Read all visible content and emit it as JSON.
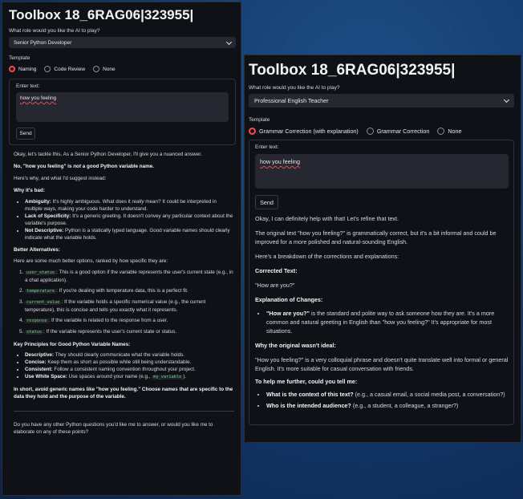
{
  "left": {
    "title": "Toolbox 18_6RAG06|323955|",
    "role_label": "What role would you like the AI to play?",
    "role_value": "Senior Python Developer",
    "template_label": "Template",
    "templates": [
      "Naming",
      "Code Review",
      "None"
    ],
    "selected_template": "Naming",
    "enter_label": "Enter text:",
    "input_text": "how you feeling",
    "send": "Send",
    "response": {
      "intro": "Okay, let's tackle this. As a Senior Python Developer, I'll give you a nuanced answer.",
      "verdict_pre": "No, \"how you feeling\" is ",
      "verdict_em": "not",
      "verdict_post": " a good Python variable name.",
      "why_line": "Here's why, and what I'd suggest instead:",
      "why_bad_heading": "Why it's bad:",
      "why_bad": [
        {
          "term": "Ambiguity:",
          "pre": " It's highly ambiguous. What does it ",
          "em": "really",
          "post": " mean? It could be interpreted in multiple ways, making your code harder to understand."
        },
        {
          "term": "Lack of Specificity:",
          "pre": " It's a generic greeting. It doesn't convey any particular context about the variable's purpose.",
          "em": "",
          "post": ""
        },
        {
          "term": "Not Descriptive:",
          "pre": " Python is a statically typed language. Good variable names should clearly indicate what the variable holds.",
          "em": "",
          "post": ""
        }
      ],
      "better_heading": "Better Alternatives:",
      "better_intro": "Here are some much better options, ranked by how specific they are:",
      "alternatives": [
        {
          "code": "user_status",
          "text": ": This is a good option if the variable represents the user's current state (e.g., in a chat application)."
        },
        {
          "code": "temperature",
          "text": ": If you're dealing with temperature data, this is a perfect fit."
        },
        {
          "code": "current_value",
          "text": ": If the variable holds a specific numerical value (e.g., the current temperature), this is concise and tells you exactly what it represents."
        },
        {
          "code": "response",
          "text": ": If the variable is related to the response from a user."
        },
        {
          "code": "status",
          "text": ": If the variable represents the user's current state or status."
        }
      ],
      "principles_heading": "Key Principles for Good Python Variable Names:",
      "principles": [
        {
          "term": "Descriptive:",
          "text": " They should clearly communicate what the variable holds.",
          "code": "",
          "tail": ""
        },
        {
          "term": "Concise:",
          "text": " Keep them as short as possible while still being understandable.",
          "code": "",
          "tail": ""
        },
        {
          "term": "Consistent:",
          "text": " Follow a consistent naming convention throughout your project.",
          "code": "",
          "tail": ""
        },
        {
          "term": "Use White Space:",
          "text": " Use spaces around your name (e.g., ",
          "code": "my_variable",
          "tail": ")."
        }
      ],
      "short": "In short, avoid generic names like \"how you feeling.\" Choose names that are specific to the data they hold and the purpose of the variable.",
      "closing": "Do you have any other Python questions you'd like me to answer, or would you like me to elaborate on any of these points?"
    }
  },
  "right": {
    "title": "Toolbox 18_6RAG06|323955|",
    "role_label": "What role would you like the AI to play?",
    "role_value": "Professional English Teacher",
    "template_label": "Template",
    "templates": [
      "Grammar Correction (with explanation)",
      "Grammar Correction",
      "None"
    ],
    "selected_template": "Grammar Correction (with explanation)",
    "enter_label": "Enter text:",
    "input_text": "how you feeling",
    "send": "Send",
    "response": {
      "intro": "Okay, I can definitely help with that! Let's refine that text.",
      "original": "The original text \"how you feeling?\" is grammatically correct, but it's a bit informal and could be improved for a more polished and natural-sounding English.",
      "breakdown": "Here's a breakdown of the corrections and explanations:",
      "corrected_heading": "Corrected Text:",
      "corrected": "\"How are you?\"",
      "explanation_heading": "Explanation of Changes:",
      "explanation_term": "\"How are you?\"",
      "explanation_text": " is the standard and polite way to ask someone how they are. It's a more common and natural greeting in English than \"how you feeling?\" It's appropriate for most situations.",
      "why_heading": "Why the original wasn't ideal:",
      "why": "\"How you feeling?\" is a very colloquial phrase and doesn't quite translate well into formal or general English. It's more suitable for casual conversation with friends.",
      "help_heading": "To help me further, could you tell me:",
      "questions": [
        {
          "term": "What is the context of this text?",
          "text": " (e.g., a casual email, a social media post, a conversation?)"
        },
        {
          "term": "Who is the intended audience?",
          "text": " (e.g., a student, a colleague, a stranger?)"
        }
      ]
    }
  }
}
